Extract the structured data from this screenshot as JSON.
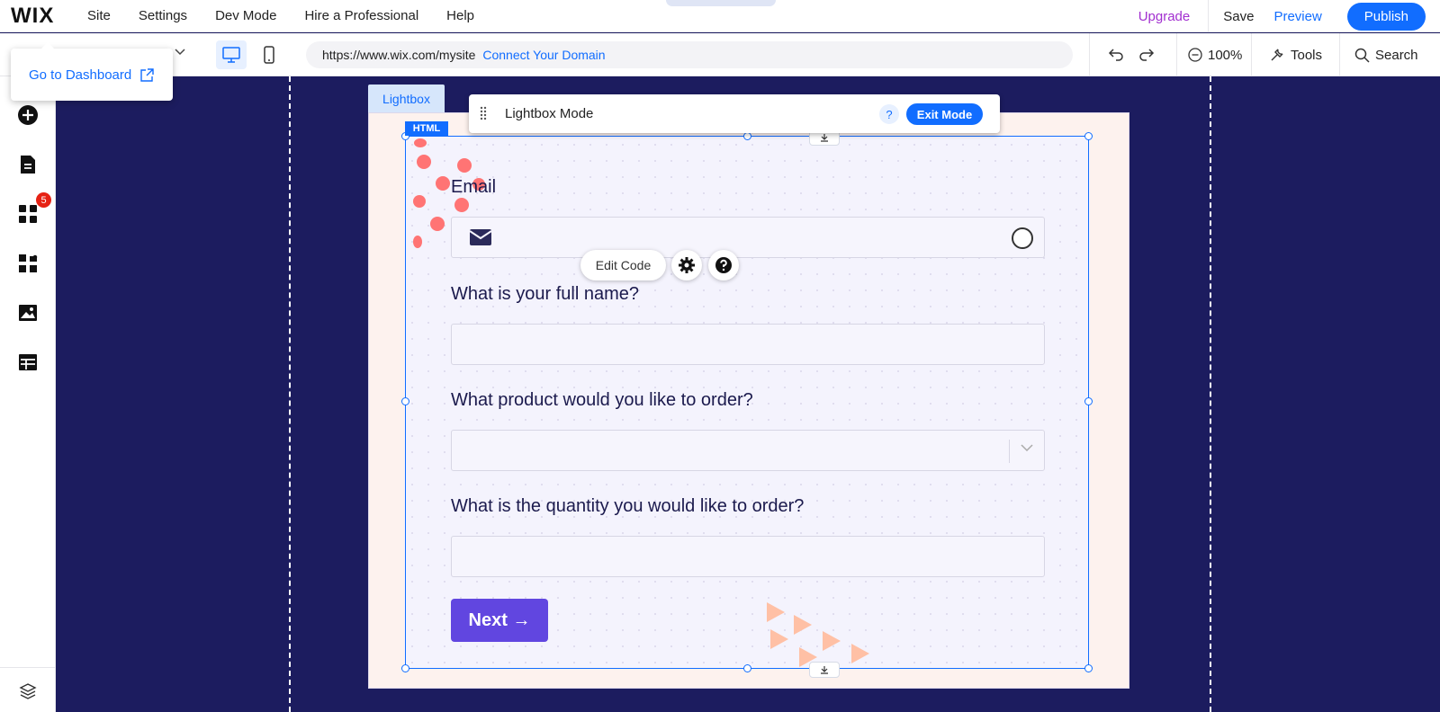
{
  "app": {
    "logo": "WIX"
  },
  "top_menu": [
    {
      "label": "Site"
    },
    {
      "label": "Settings"
    },
    {
      "label": "Dev Mode"
    },
    {
      "label": "Hire a Professional"
    },
    {
      "label": "Help"
    }
  ],
  "top_right": {
    "upgrade_label": "Upgrade",
    "save_label": "Save",
    "preview_label": "Preview",
    "publish_label": "Publish"
  },
  "toolbar": {
    "url": "https://www.wix.com/mysite",
    "connect_domain": "Connect Your Domain",
    "zoom": "100%",
    "tools_label": "Tools",
    "search_label": "Search"
  },
  "dashboard_popover": {
    "label": "Go to Dashboard"
  },
  "sidebar": {
    "apps_badge": "5",
    "icons": [
      "add-icon",
      "pages-icon",
      "apps-icon",
      "extensions-icon",
      "media-icon",
      "cms-icon",
      "layers-icon"
    ]
  },
  "lightbox": {
    "tab_label": "Lightbox",
    "element_tag": "HTML",
    "mode_title": "Lightbox Mode",
    "mode_help": "?",
    "exit_label": "Exit Mode"
  },
  "edit_code": {
    "label": "Edit Code"
  },
  "form": {
    "email_label": "Email",
    "name_label": "What is your full name?",
    "product_label": "What product would you like to order?",
    "quantity_label": "What is the quantity you would like to order?",
    "next_label": "Next →"
  },
  "colors": {
    "accent": "#116dff",
    "canvas_bg": "#1c1c5f",
    "next_button": "#6146e0",
    "upgrade": "#a22fd0",
    "badge": "#e62214"
  }
}
